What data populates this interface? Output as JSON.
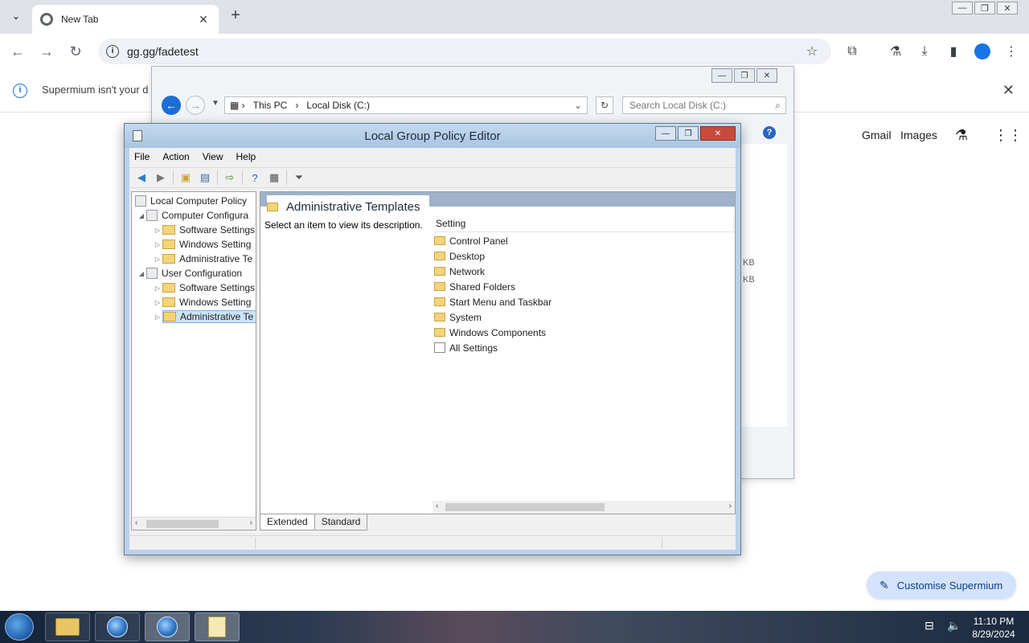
{
  "browser": {
    "tab_title": "New Tab",
    "url": "gg.gg/fadetest",
    "infobar_text": "Supermium isn't your d",
    "google_links": [
      "Gmail",
      "Images"
    ],
    "customise_label": "Customise Supermium"
  },
  "explorer": {
    "breadcrumb": [
      "This PC",
      "Local Disk (C:)"
    ],
    "search_placeholder": "Search Local Disk (C:)",
    "sizes": [
      "KB",
      "KB"
    ]
  },
  "gpe": {
    "title": "Local Group Policy Editor",
    "menu": [
      "File",
      "Action",
      "View",
      "Help"
    ],
    "tree": {
      "root": "Local Computer Policy",
      "computer": "Computer Configura",
      "computer_children": [
        "Software Settings",
        "Windows Setting",
        "Administrative Te"
      ],
      "user": "User Configuration",
      "user_children": [
        "Software Settings",
        "Windows Setting",
        "Administrative Te"
      ]
    },
    "details": {
      "header": "Administrative Templates",
      "description": "Select an item to view its description.",
      "column": "Setting",
      "items": [
        "Control Panel",
        "Desktop",
        "Network",
        "Shared Folders",
        "Start Menu and Taskbar",
        "System",
        "Windows Components",
        "All Settings"
      ]
    },
    "tabs": [
      "Extended",
      "Standard"
    ]
  },
  "taskbar": {
    "time": "11:10 PM",
    "date": "8/29/2024"
  }
}
